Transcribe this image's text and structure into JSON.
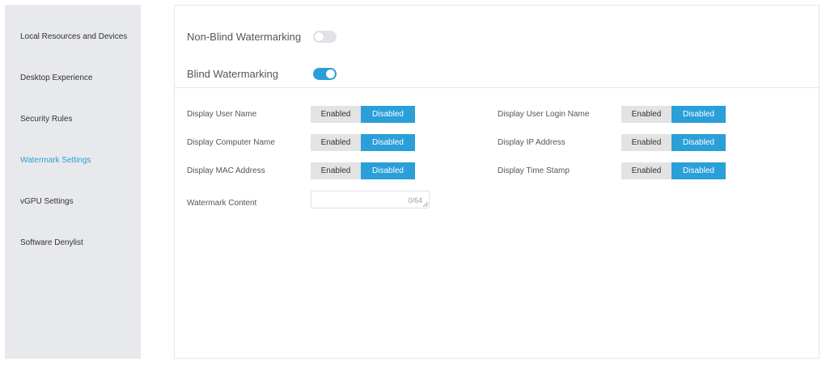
{
  "sidebar": {
    "items": [
      {
        "label": "Local Resources and Devices",
        "active": false
      },
      {
        "label": "Desktop Experience",
        "active": false
      },
      {
        "label": "Security Rules",
        "active": false
      },
      {
        "label": "Watermark Settings",
        "active": true
      },
      {
        "label": "vGPU Settings",
        "active": false
      },
      {
        "label": "Software Denylist",
        "active": false
      }
    ]
  },
  "watermark": {
    "non_blind": {
      "label": "Non-Blind Watermarking",
      "enabled": false
    },
    "blind": {
      "label": "Blind Watermarking",
      "enabled": true
    },
    "options": [
      {
        "label": "Display User Name",
        "enabled_label": "Enabled",
        "disabled_label": "Disabled",
        "selected": "Disabled"
      },
      {
        "label": "Display User Login Name",
        "enabled_label": "Enabled",
        "disabled_label": "Disabled",
        "selected": "Disabled"
      },
      {
        "label": "Display Computer Name",
        "enabled_label": "Enabled",
        "disabled_label": "Disabled",
        "selected": "Disabled"
      },
      {
        "label": "Display IP Address",
        "enabled_label": "Enabled",
        "disabled_label": "Disabled",
        "selected": "Disabled"
      },
      {
        "label": "Display MAC Address",
        "enabled_label": "Enabled",
        "disabled_label": "Disabled",
        "selected": "Disabled"
      },
      {
        "label": "Display Time Stamp",
        "enabled_label": "Enabled",
        "disabled_label": "Disabled",
        "selected": "Disabled"
      }
    ],
    "content": {
      "label": "Watermark Content",
      "value": "",
      "counter": "0/64"
    }
  },
  "colors": {
    "accent": "#2a9fd8",
    "sidebar_bg": "#e8e9ec",
    "segment_off": "#e3e3e3"
  }
}
